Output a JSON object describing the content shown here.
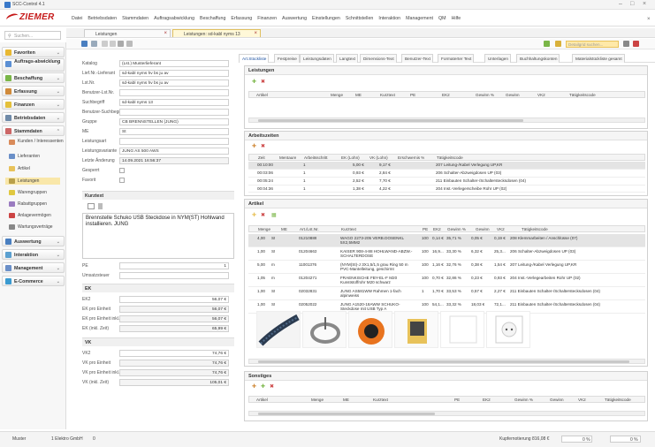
{
  "window": {
    "title": "SCC-Control 4.1"
  },
  "brand": {
    "logo": "ZIEMER",
    "color": "#c61b1b"
  },
  "menu": [
    "Datei",
    "Betriebsdaten",
    "Stammdaten",
    "Auftragsabwicklung",
    "Beschaffung",
    "Erfassung",
    "Finanzen",
    "Auswertung",
    "Einstellungen",
    "Schnittstellen",
    "Interaktion",
    "Management",
    "QM",
    "Hilfe"
  ],
  "search": {
    "placeholder": "Suchen..."
  },
  "doc_tabs": [
    {
      "label": "Leistungen"
    },
    {
      "label": "Leistungen: sd-kabl nyms 13"
    }
  ],
  "toolbar": {
    "search_placeholder": "Detailgrid suchen..."
  },
  "sidebar": {
    "groups": [
      {
        "label": "Favoriten"
      },
      {
        "label": "Auftrags-abwicklung"
      },
      {
        "label": "Beschaffung"
      },
      {
        "label": "Erfassung"
      },
      {
        "label": "Finanzen"
      },
      {
        "label": "Betriebsdaten"
      },
      {
        "label": "Stammdaten"
      },
      {
        "label": "Auswertung"
      },
      {
        "label": "Interaktion"
      },
      {
        "label": "Management"
      },
      {
        "label": "E-Commerce"
      }
    ],
    "stammdaten_items": [
      "Kunden / Interessenten",
      "Lieferanten",
      "Artikel",
      "Leistungen",
      "Warengruppen",
      "Rabattgruppen",
      "Anlagevermögen",
      "Wartungsverträge"
    ]
  },
  "form": {
    "fields": [
      {
        "label": "Katalog",
        "value": "(Lst.) Musterlieferant"
      },
      {
        "label": "Lief.Nr.-Lieferant",
        "value": "sd-kabl nyms hv bs ju av"
      },
      {
        "label": "Lst.Nr.",
        "value": "sd-kabl nyms hv bs ju av"
      },
      {
        "label": "Benutzer-Lst.Nr.",
        "value": ""
      },
      {
        "label": "Suchbegriff",
        "value": "sd-kabl nyms 13"
      },
      {
        "label": "Benutzer-Suchbegriff",
        "value": ""
      },
      {
        "label": "Gruppe",
        "value": "CB BRENNSTELLEN (JUNG)"
      },
      {
        "label": "ME",
        "value": "St"
      },
      {
        "label": "Leistungsart",
        "value": ""
      },
      {
        "label": "Leistungsvariante",
        "value": "JUNG AS 500 AWS"
      },
      {
        "label": "Letzte Änderung",
        "value": "14.09.2021 16:56:37"
      },
      {
        "label": "Gesperrt",
        "value": ""
      },
      {
        "label": "Favorit",
        "value": ""
      }
    ],
    "kurztext": {
      "title": "Kurztext",
      "text": "Brennstelle Schuko USB Steckdose in NYM(ST) Hohlwand installieren. JUNG"
    },
    "pe": {
      "label": "PE",
      "value": "1"
    },
    "umsatzsteuer": {
      "label": "Umsatzsteuer",
      "value": ""
    },
    "ek": {
      "title": "EK",
      "rows": [
        {
          "label": "EK2",
          "value": "56,07 €"
        },
        {
          "label": "EK pro Einheit",
          "value": "56,07 €"
        },
        {
          "label": "EK pro Einheit inkl. USt.",
          "value": "56,07 €"
        },
        {
          "label": "EK (inkl. Zeit)",
          "value": "65,99 €"
        }
      ]
    },
    "vk": {
      "title": "VK",
      "rows": [
        {
          "label": "VK2",
          "value": "74,76 €"
        },
        {
          "label": "VK pro Einheit",
          "value": "74,76 €"
        },
        {
          "label": "VK pro Einheit inkl. USt.",
          "value": "74,76 €"
        },
        {
          "label": "VK (inkl. Zeit)",
          "value": "105,01 €"
        }
      ]
    }
  },
  "right_tabs": [
    "Art.Stückliste",
    "Festpreise",
    "Leistungsdaten",
    "Langtext",
    "Dimensions-Text",
    "Benutzer-Text",
    "Formaterter Text",
    "Unterlagen",
    "Buchhaltungskonten",
    "Materialstückliste gesamt"
  ],
  "leistungen": {
    "title": "Leistungen",
    "headers": [
      "Artikel",
      "Menge",
      "ME",
      "Kurztext",
      "PE",
      "EK2",
      "Gewinn %",
      "Gewinn",
      "VK2",
      "Tätigkeitscode"
    ]
  },
  "arbeitszeiten": {
    "title": "Arbeitszeiten",
    "headers": [
      "Zeit",
      "Mentaure",
      "Arbeitsschritt",
      "EK (Lohn)",
      "VK (Lohn)",
      "Erschwernis %",
      "Tätigkeitscode"
    ],
    "rows": [
      [
        "00:10:00",
        "1",
        "",
        "5,00 €",
        "9,17 €",
        "",
        "207 Leitung-/Kabel Verlegung UP,KR"
      ],
      [
        "00:03:06",
        "1",
        "",
        "0,93 €",
        "2,84 €",
        "",
        "206 Schalter-Abzweigdosen UP (03)"
      ],
      [
        "00:05:24",
        "1",
        "",
        "2,52 €",
        "7,70 €",
        "",
        "211 Einbauten Schalter-/Schalterstecksdosen (04)"
      ],
      [
        "00:04:36",
        "1",
        "",
        "1,38 €",
        "4,22 €",
        "",
        "204 Inst.-Verlegerscheibe Rohr UP (02)"
      ]
    ]
  },
  "artikel": {
    "title": "Artikel",
    "headers": [
      "Menge",
      "ME",
      "Art./Lst.Nr.",
      "Kurztext",
      "PE",
      "EK2",
      "Gewinn %",
      "Gewinn",
      "VK2",
      "Tätigkeitscode"
    ],
    "rows": [
      [
        "4,00",
        "St",
        "01210889",
        "WAGO 2273-205 VERB.DOSENKL 5X2,5MM2",
        "100",
        "0,14 €",
        "35,71 %",
        "0,05 €",
        "0,19 €",
        "208 Klemmarbeiten / Anschlüsse (07)"
      ],
      [
        "1,00",
        "St",
        "01204663",
        "KAISER 908-4-88 HOHLWAND-ABZW.-SCHALTERDOSE",
        "100",
        "16,9...",
        "33,30 %",
        "6,32 €",
        "25,3...",
        "206 Schalter-Abzweigdosen UP (03)"
      ],
      [
        "5,00",
        "m",
        "11001376",
        "(NYM(St)-J 3X1,5/1,5 grau Ring 50 m PVC-Mantelleitung, geschirmt",
        "100",
        "1,16 €",
        "32,76 %",
        "0,38 €",
        "1,54 €",
        "207 Leitung-/Kabel Verlegung UP,KR"
      ],
      [
        "1,05",
        "m",
        "01204271",
        "FRAENKISCHE FBY-EL-F M20 Kunststoffrohr M20 schwarz",
        "100",
        "0,70 €",
        "32,86 %",
        "0,23 €",
        "0,93 €",
        "204 Inst.-Verlegearbeiten Rohr UP (02)"
      ],
      [
        "1,00",
        "St",
        "02032831",
        "JUNG AS581WW Rahmen 1-fach alpinweiss",
        "1",
        "1,70 €",
        "33,53 %",
        "0,57 €",
        "2,27 €",
        "211 Einbauten Schalter-/Schalterstecksdosen (04)"
      ],
      [
        "1,00",
        "St",
        "02052022",
        "JUNG A1520-18AWW SCHUKO-Steckdose mit USB Typ A",
        "100",
        "54,1...",
        "33,32 %",
        "18,03 €",
        "72,1...",
        "211 Einbauten Schalter-/Schalterstecksdosen (04)"
      ]
    ]
  },
  "sonstiges": {
    "title": "Sonstiges",
    "headers": [
      "Artikel",
      "Menge",
      "ME",
      "Kurztext",
      "PE",
      "EK2",
      "Gewinn %",
      "Gewinn",
      "VK2",
      "Tätigkeitscode"
    ]
  },
  "status": {
    "user": "Muster",
    "company": "1 Elektro GmbH",
    "count": "0",
    "kupfer": "Kupfernotierung 816,08 €",
    "pct1": "0 %",
    "pct2": "0 %"
  }
}
